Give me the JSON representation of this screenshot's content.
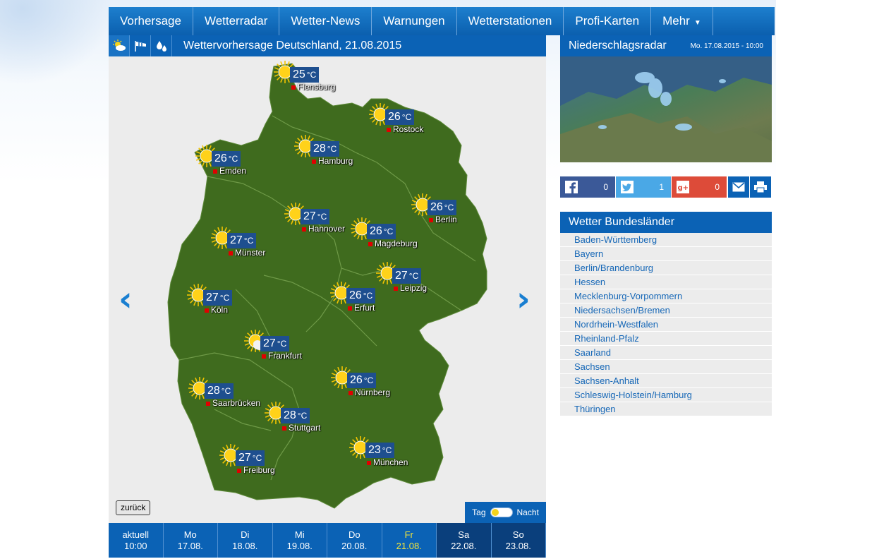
{
  "nav": {
    "items": [
      "Vorhersage",
      "Wetterradar",
      "Wetter-News",
      "Warnungen",
      "Wetterstationen",
      "Profi-Karten",
      "Mehr"
    ]
  },
  "forecast": {
    "title": "Wettervorhersage Deutschland, 21.08.2015",
    "back_label": "zurück",
    "day_label": "Tag",
    "night_label": "Nacht"
  },
  "cities": [
    {
      "name": "Flensburg",
      "temp": "25",
      "unit": "°C",
      "icon": "sun-icon"
    },
    {
      "name": "Rostock",
      "temp": "26",
      "unit": "°C",
      "icon": "sun-icon"
    },
    {
      "name": "Hamburg",
      "temp": "28",
      "unit": "°C",
      "icon": "sun-icon"
    },
    {
      "name": "Emden",
      "temp": "26",
      "unit": "°C",
      "icon": "sun-icon"
    },
    {
      "name": "Berlin",
      "temp": "26",
      "unit": "°C",
      "icon": "sun-icon"
    },
    {
      "name": "Hannover",
      "temp": "27",
      "unit": "°C",
      "icon": "sun-icon"
    },
    {
      "name": "Magdeburg",
      "temp": "26",
      "unit": "°C",
      "icon": "sun-icon"
    },
    {
      "name": "Münster",
      "temp": "27",
      "unit": "°C",
      "icon": "sun-icon"
    },
    {
      "name": "Leipzig",
      "temp": "27",
      "unit": "°C",
      "icon": "sun-icon"
    },
    {
      "name": "Köln",
      "temp": "27",
      "unit": "°C",
      "icon": "sun-icon"
    },
    {
      "name": "Erfurt",
      "temp": "26",
      "unit": "°C",
      "icon": "sun-icon"
    },
    {
      "name": "Frankfurt",
      "temp": "27",
      "unit": "°C",
      "icon": "sun-cloud-icon"
    },
    {
      "name": "Nürnberg",
      "temp": "26",
      "unit": "°C",
      "icon": "sun-icon"
    },
    {
      "name": "Saarbrücken",
      "temp": "28",
      "unit": "°C",
      "icon": "sun-icon"
    },
    {
      "name": "Stuttgart",
      "temp": "28",
      "unit": "°C",
      "icon": "sun-icon"
    },
    {
      "name": "Freiburg",
      "temp": "27",
      "unit": "°C",
      "icon": "sun-icon"
    },
    {
      "name": "München",
      "temp": "23",
      "unit": "°C",
      "icon": "sun-icon"
    }
  ],
  "days": [
    {
      "l1": "aktuell",
      "l2": "10:00",
      "selected": false,
      "dark": false
    },
    {
      "l1": "Mo",
      "l2": "17.08.",
      "selected": false,
      "dark": false
    },
    {
      "l1": "Di",
      "l2": "18.08.",
      "selected": false,
      "dark": false
    },
    {
      "l1": "Mi",
      "l2": "19.08.",
      "selected": false,
      "dark": false
    },
    {
      "l1": "Do",
      "l2": "20.08.",
      "selected": false,
      "dark": false
    },
    {
      "l1": "Fr",
      "l2": "21.08.",
      "selected": true,
      "dark": false
    },
    {
      "l1": "Sa",
      "l2": "22.08.",
      "selected": false,
      "dark": true
    },
    {
      "l1": "So",
      "l2": "23.08.",
      "selected": false,
      "dark": true
    }
  ],
  "radar": {
    "title": "Niederschlagsradar",
    "date": "Mo. 17.08.2015 - 10:00"
  },
  "share": {
    "facebook_count": "0",
    "twitter_count": "1",
    "googleplus_count": "0"
  },
  "bundeslaender": {
    "title": "Wetter Bundesländer",
    "items": [
      "Baden-Württemberg",
      "Bayern",
      "Berlin/Brandenburg",
      "Hessen",
      "Mecklenburg-Vorpommern",
      "Niedersachsen/Bremen",
      "Nordrhein-Westfalen",
      "Rheinland-Pfalz",
      "Saarland",
      "Sachsen",
      "Sachsen-Anhalt",
      "Schleswig-Holstein/Hamburg",
      "Thüringen"
    ]
  },
  "colors": {
    "primary_blue": "#0b62b5",
    "map_green": "#3f6b1e",
    "temp_box": "#1e4f8f",
    "selected_day": "#f4e53a"
  }
}
